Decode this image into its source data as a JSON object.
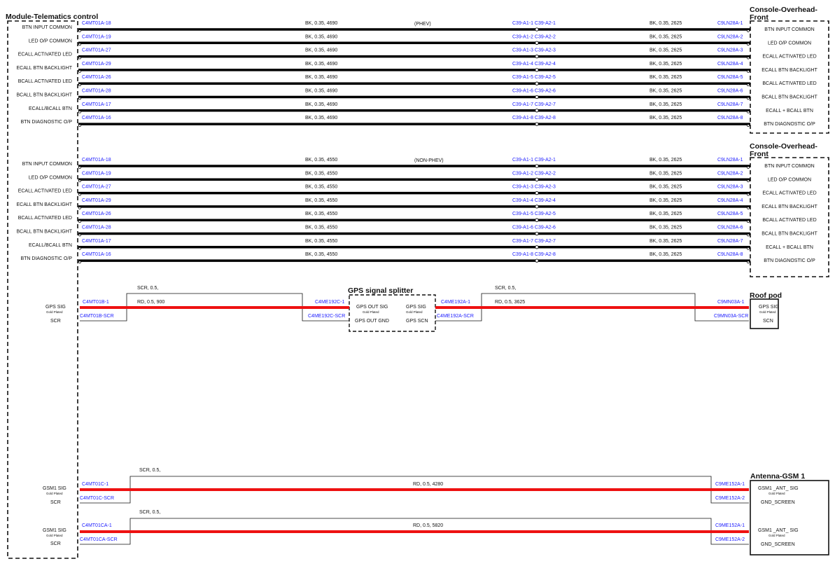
{
  "titles": {
    "module": "Module-Telematics control",
    "console_phev": "Console-Overhead-\nFront",
    "console_nonphev": "Console-Overhead-\nFront",
    "gps_splitter": "GPS signal splitter",
    "roof_pod": "Roof pod",
    "antenna": "Antenna-GSM 1"
  },
  "colors": {
    "black_wire": "#000000",
    "red_wire": "#ee1111",
    "conn_text": "#1a1aff",
    "text": "#111111"
  },
  "phev": {
    "note": "(PHEV)",
    "rows": [
      {
        "pin": "C4MT01A-18",
        "left": "BTN INPUT COMMON",
        "wire1": "BK, 0.35, 4690",
        "splice": "C39-A1-1  C39-A2-1",
        "wire2": "BK, 0.35, 2625",
        "dest": "C9LN28A-1",
        "right": "BTN INPUT COMMON"
      },
      {
        "pin": "C4MT01A-19",
        "left": "LED O/P COMMON",
        "wire1": "BK, 0.35, 4690",
        "splice": "C39-A1-2  C39-A2-2",
        "wire2": "BK, 0.35, 2625",
        "dest": "C9LN28A-2",
        "right": "LED O/P COMMON"
      },
      {
        "pin": "C4MT01A-27",
        "left": "ECALL ACTIVATED LED",
        "wire1": "BK, 0.35, 4690",
        "splice": "C39-A1-3  C39-A2-3",
        "wire2": "BK, 0.35, 2625",
        "dest": "C9LN28A-3",
        "right": "ECALL ACTIVATED LED"
      },
      {
        "pin": "C4MT01A-29",
        "left": "ECALL BTN BACKLIGHT",
        "wire1": "BK, 0.35, 4690",
        "splice": "C39-A1-4  C39-A2-4",
        "wire2": "BK, 0.35, 2625",
        "dest": "C9LN28A-4",
        "right": "ECALL BTN BACKLIGHT"
      },
      {
        "pin": "C4MT01A-26",
        "left": "BCALL ACTIVATED LED",
        "wire1": "BK, 0.35, 4690",
        "splice": "C39-A1-5  C39-A2-5",
        "wire2": "BK, 0.35, 2625",
        "dest": "C9LN28A-5",
        "right": "BCALL ACTIVATED LED"
      },
      {
        "pin": "C4MT01A-28",
        "left": "BCALL BTN BACKLIGHT",
        "wire1": "BK, 0.35, 4690",
        "splice": "C39-A1-6  C39-A2-6",
        "wire2": "BK, 0.35, 2625",
        "dest": "C9LN28A-6",
        "right": "BCALL BTN BACKLIGHT"
      },
      {
        "pin": "C4MT01A-17",
        "left": "ECALL/BCALL BTN",
        "wire1": "BK, 0.35, 4690",
        "splice": "C39-A1-7  C39-A2-7",
        "wire2": "BK, 0.35, 2625",
        "dest": "C9LN28A-7",
        "right": "ECALL + BCALL BTN"
      },
      {
        "pin": "C4MT01A-16",
        "left": "BTN DIAGNOSTIC O/P",
        "wire1": "BK, 0.35, 4690",
        "splice": "C39-A1-8  C39-A2-8",
        "wire2": "BK, 0.35, 2625",
        "dest": "C9LN28A-8",
        "right": "BTN DIAGNOSTIC O/P"
      }
    ]
  },
  "nonphev": {
    "note": "(NON-PHEV)",
    "rows": [
      {
        "pin": "C4MT01A-18",
        "left": "BTN INPUT COMMON",
        "wire1": "BK, 0.35, 4550",
        "splice": "C39-A1-1  C39-A2-1",
        "wire2": "BK, 0.35, 2625",
        "dest": "C9LN28A-1",
        "right": "BTN INPUT COMMON"
      },
      {
        "pin": "C4MT01A-19",
        "left": "LED O/P COMMON",
        "wire1": "BK, 0.35, 4550",
        "splice": "C39-A1-2  C39-A2-2",
        "wire2": "BK, 0.35, 2625",
        "dest": "C9LN28A-2",
        "right": "LED O/P COMMON"
      },
      {
        "pin": "C4MT01A-27",
        "left": "ECALL ACTIVATED LED",
        "wire1": "BK, 0.35, 4550",
        "splice": "C39-A1-3  C39-A2-3",
        "wire2": "BK, 0.35, 2625",
        "dest": "C9LN28A-3",
        "right": "ECALL ACTIVATED LED"
      },
      {
        "pin": "C4MT01A-29",
        "left": "ECALL BTN BACKLIGHT",
        "wire1": "BK, 0.35, 4550",
        "splice": "C39-A1-4  C39-A2-4",
        "wire2": "BK, 0.35, 2625",
        "dest": "C9LN28A-4",
        "right": "ECALL BTN BACKLIGHT"
      },
      {
        "pin": "C4MT01A-26",
        "left": "BCALL ACTIVATED LED",
        "wire1": "BK, 0.35, 4550",
        "splice": "C39-A1-5  C39-A2-5",
        "wire2": "BK, 0.35, 2625",
        "dest": "C9LN28A-5",
        "right": "BCALL ACTIVATED LED"
      },
      {
        "pin": "C4MT01A-28",
        "left": "BCALL BTN BACKLIGHT",
        "wire1": "BK, 0.35, 4550",
        "splice": "C39-A1-6  C39-A2-6",
        "wire2": "BK, 0.35, 2625",
        "dest": "C9LN28A-6",
        "right": "BCALL BTN BACKLIGHT"
      },
      {
        "pin": "C4MT01A-17",
        "left": "ECALL/BCALL BTN",
        "wire1": "BK, 0.35, 4550",
        "splice": "C39-A1-7  C39-A2-7",
        "wire2": "BK, 0.35, 2625",
        "dest": "C9LN28A-7",
        "right": "ECALL + BCALL BTN"
      },
      {
        "pin": "C4MT01A-16",
        "left": "BTN DIAGNOSTIC O/P",
        "wire1": "BK, 0.35, 4550",
        "splice": "C39-A1-8  C39-A2-8",
        "wire2": "BK, 0.35, 2625",
        "dest": "C9LN28A-8",
        "right": "BTN DIAGNOSTIC O/P"
      }
    ]
  },
  "gps": {
    "left_sig": "GPS SIG",
    "left_sig_sub": "Gold Plated",
    "left_scr": "SCR",
    "pin_sig": "C4MT01B-1",
    "pin_scr": "C4MT01B-SCR",
    "scr1": "SCR,  0.5,",
    "wire1": "RD,  0.5,  900",
    "splitter_in_sig_pin": "C4ME192C-1",
    "splitter_in_scr_pin": "C4ME192C-SCR",
    "splitter_out_sig": "GPS OUT SIG",
    "splitter_out_sig_sub": "Gold Plated",
    "splitter_out_gnd": "GPS OUT GND",
    "splitter_gps_sig": "GPS SIG",
    "splitter_gps_sig_sub": "Gold Plated",
    "splitter_gps_scn": "GPS SCN",
    "splitter_out_sig_pin": "C4ME192A-1",
    "splitter_out_scr_pin": "C4ME192A-SCR",
    "scr2": "SCR,  0.5,",
    "wire2": "RD,  0.5,  3625",
    "roof_sig_pin": "C9MN03A-1",
    "roof_scr_pin": "C9MN03A-SCR",
    "roof_sig": "GPS SIG",
    "roof_sig_sub": "Gold Plated",
    "roof_scn": "SCN"
  },
  "gsm": [
    {
      "left_sig": "GSM1 SIG",
      "left_sub": "Gold Plated",
      "left_scr": "SCR",
      "pin_sig": "C4MT01C-1",
      "pin_scr": "C4MT01C-SCR",
      "scr": "SCR,  0.5,",
      "wire": "RD,  0.5,  4280",
      "dest_sig": "C9ME152A-1",
      "dest_scr": "C9ME152A-2",
      "right_sig": "GSM1 _ANT_ SIG",
      "right_sub": "Gold Plated",
      "right_scr": "GND_SCREEN"
    },
    {
      "left_sig": "GSM1 SIG",
      "left_sub": "Gold Plated",
      "left_scr": "SCR",
      "pin_sig": "C4MT01CA-1",
      "pin_scr": "C4MT01CA-SCR",
      "scr": "SCR,  0.5,",
      "wire": "RD,  0.5,  5820",
      "dest_sig": "C9ME152A-1",
      "dest_scr": "C9ME152A-2",
      "right_sig": "GSM1 _ANT_ SIG",
      "right_sub": "Gold Plated",
      "right_scr": "GND_SCREEN"
    }
  ]
}
